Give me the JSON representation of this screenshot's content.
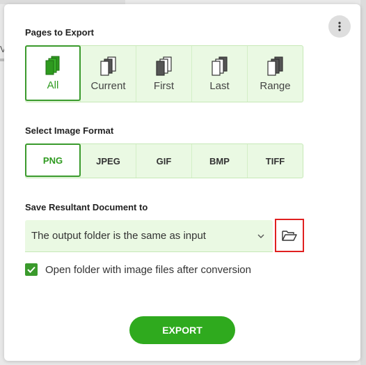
{
  "menu": {
    "icon": "more-vertical-icon"
  },
  "pages_section": {
    "title": "Pages to Export",
    "options": [
      {
        "label": "All",
        "icon": "pages-stack-icon",
        "selected": true
      },
      {
        "label": "Current",
        "icon": "current-page-icon",
        "selected": false
      },
      {
        "label": "First",
        "icon": "first-page-icon",
        "selected": false
      },
      {
        "label": "Last",
        "icon": "last-page-icon",
        "selected": false
      },
      {
        "label": "Range",
        "icon": "page-range-icon",
        "selected": false
      }
    ]
  },
  "format_section": {
    "title": "Select Image Format",
    "options": [
      {
        "label": "PNG",
        "selected": true
      },
      {
        "label": "JPEG",
        "selected": false
      },
      {
        "label": "GIF",
        "selected": false
      },
      {
        "label": "BMP",
        "selected": false
      },
      {
        "label": "TIFF",
        "selected": false
      }
    ]
  },
  "save_section": {
    "title": "Save Resultant Document to",
    "dropdown_value": "The output folder is the same as input",
    "folder_icon": "folder-open-icon"
  },
  "open_folder": {
    "label": "Open folder with image files after conversion",
    "checked": true
  },
  "export_button": {
    "label": "EXPORT"
  },
  "colors": {
    "accent": "#2faa1e",
    "selected_border": "#3a9a2c",
    "option_bg": "#eaf9e3",
    "highlight": "#e02020"
  }
}
